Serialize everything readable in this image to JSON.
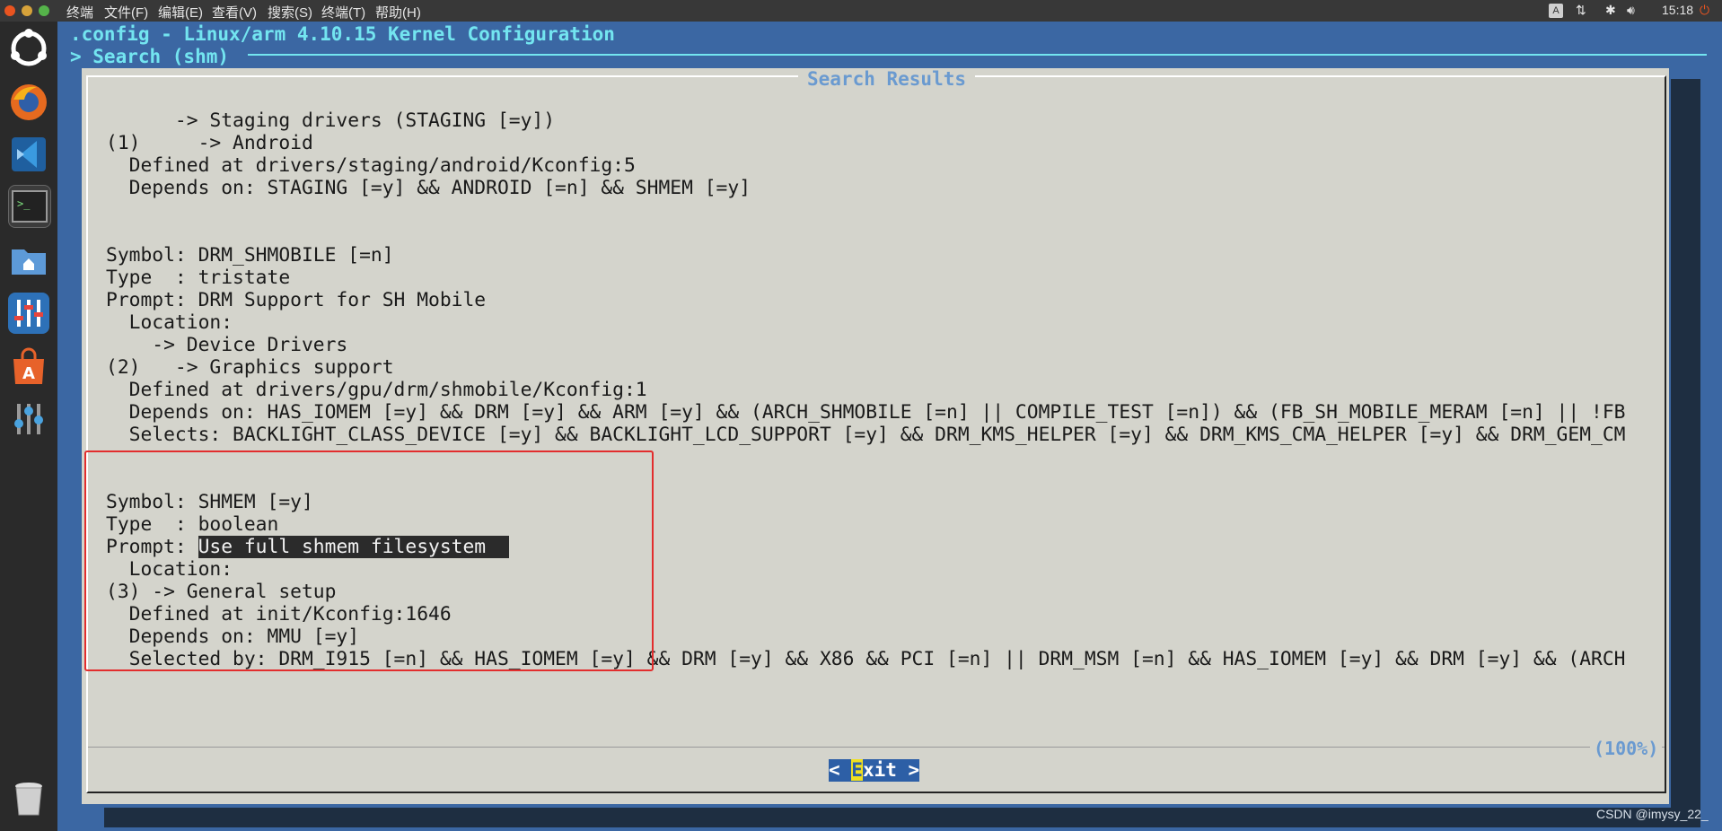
{
  "topbar": {
    "menus": [
      "终端",
      "文件(F)",
      "编辑(E)",
      "查看(V)",
      "搜索(S)",
      "终端(T)",
      "帮助(H)"
    ],
    "time": "15:18",
    "tray_icons": [
      "keyboard-layout-icon",
      "network-icon",
      "bluetooth-icon",
      "volume-icon",
      "power-icon"
    ]
  },
  "launcher": {
    "items": [
      "ubuntu-dash-icon",
      "firefox-icon",
      "vscode-icon",
      "terminal-icon",
      "files-icon",
      "mixer-icon",
      "software-center-icon",
      "settings-icon",
      "trash-icon"
    ]
  },
  "terminal": {
    "title_line": ".config - Linux/arm 4.10.15 Kernel Configuration",
    "breadcrumb": "> Search (shm)",
    "dialog_title": "Search Results",
    "lines": [
      "      -> Staging drivers (STAGING [=y])",
      "(1)     -> Android",
      "  Defined at drivers/staging/android/Kconfig:5",
      "  Depends on: STAGING [=y] && ANDROID [=n] && SHMEM [=y]",
      "",
      "",
      "Symbol: DRM_SHMOBILE [=n]",
      "Type  : tristate",
      "Prompt: DRM Support for SH Mobile",
      "  Location:",
      "    -> Device Drivers",
      "(2)   -> Graphics support",
      "  Defined at drivers/gpu/drm/shmobile/Kconfig:1",
      "  Depends on: HAS_IOMEM [=y] && DRM [=y] && ARM [=y] && (ARCH_SHMOBILE [=n] || COMPILE_TEST [=n]) && (FB_SH_MOBILE_MERAM [=n] || !FB",
      "  Selects: BACKLIGHT_CLASS_DEVICE [=y] && BACKLIGHT_LCD_SUPPORT [=y] && DRM_KMS_HELPER [=y] && DRM_KMS_CMA_HELPER [=y] && DRM_GEM_CM",
      "",
      "",
      "Symbol: SHMEM [=y]",
      "Type  : boolean",
      "Prompt: ",
      "  Location:",
      "(3) -> General setup",
      "  Defined at init/Kconfig:1646",
      "  Depends on: MMU [=y]",
      "  Selected by: DRM_I915 [=n] && HAS_IOMEM [=y] && DRM [=y] && X86 && PCI [=n] || DRM_MSM [=n] && HAS_IOMEM [=y] && DRM [=y] && (ARCH"
    ],
    "highlighted_prompt": "Use full shmem filesystem  ",
    "percent": "(100%)",
    "exit_left": "< ",
    "exit_hot": "E",
    "exit_right": "xit >"
  },
  "watermark": "CSDN @imysy_22_",
  "colors": {
    "terminal_bg": "#3b67a3",
    "header_cyan": "#73e5f0",
    "dialog_bg": "#d4d4cc",
    "title_blue": "#6a9ad0",
    "annotation_red": "#e22d2d"
  }
}
